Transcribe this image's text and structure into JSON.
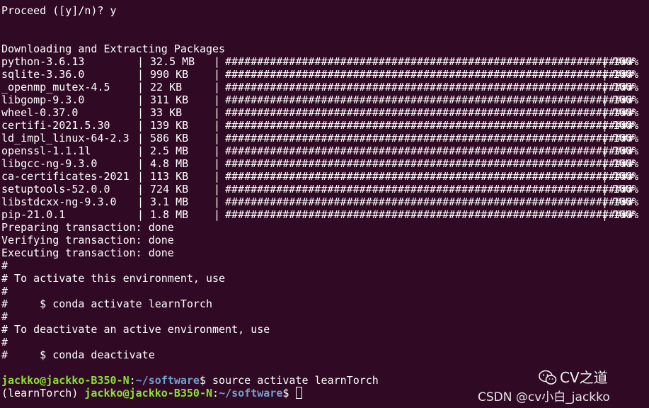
{
  "terminal": {
    "prompt_line": "Proceed ([y]/n)? y",
    "download_header": "Downloading and Extracting Packages",
    "bar": "################################################################",
    "packages": [
      {
        "name": "python-3.6.13",
        "size": "32.5 MB",
        "percent": "100%"
      },
      {
        "name": "sqlite-3.36.0",
        "size": "990 KB",
        "percent": "100%"
      },
      {
        "name": "_openmp_mutex-4.5",
        "size": "22 KB",
        "percent": "100%"
      },
      {
        "name": "libgomp-9.3.0",
        "size": "311 KB",
        "percent": "100%"
      },
      {
        "name": "wheel-0.37.0",
        "size": "33 KB",
        "percent": "100%"
      },
      {
        "name": "certifi-2021.5.30",
        "size": "139 KB",
        "percent": "100%"
      },
      {
        "name": "ld_impl_linux-64-2.3",
        "size": "586 KB",
        "percent": "100%"
      },
      {
        "name": "openssl-1.1.1l",
        "size": "2.5 MB",
        "percent": "100%"
      },
      {
        "name": "libgcc-ng-9.3.0",
        "size": "4.8 MB",
        "percent": "100%"
      },
      {
        "name": "ca-certificates-2021",
        "size": "113 KB",
        "percent": "100%"
      },
      {
        "name": "setuptools-52.0.0",
        "size": "724 KB",
        "percent": "100%"
      },
      {
        "name": "libstdcxx-ng-9.3.0",
        "size": "3.1 MB",
        "percent": "100%"
      },
      {
        "name": "pip-21.0.1",
        "size": "1.8 MB",
        "percent": "100%"
      }
    ],
    "status_lines": [
      "Preparing transaction: done",
      "Verifying transaction: done",
      "Executing transaction: done",
      "#",
      "# To activate this environment, use",
      "#",
      "#     $ conda activate learnTorch",
      "#",
      "# To deactivate an active environment, use",
      "#",
      "#     $ conda deactivate"
    ],
    "command_prompt": {
      "user_host": "jackko@jackko-B350-N",
      "path": "~/software",
      "command": "source activate learnTorch"
    },
    "active_prompt": {
      "env": "(learnTorch)",
      "user_host": "jackko@jackko-B350-N",
      "path": "~/software"
    }
  },
  "watermark": {
    "logo_icon": "wechat-icon",
    "name": "CV之道",
    "user": "CSDN @cv小白_jackko"
  }
}
